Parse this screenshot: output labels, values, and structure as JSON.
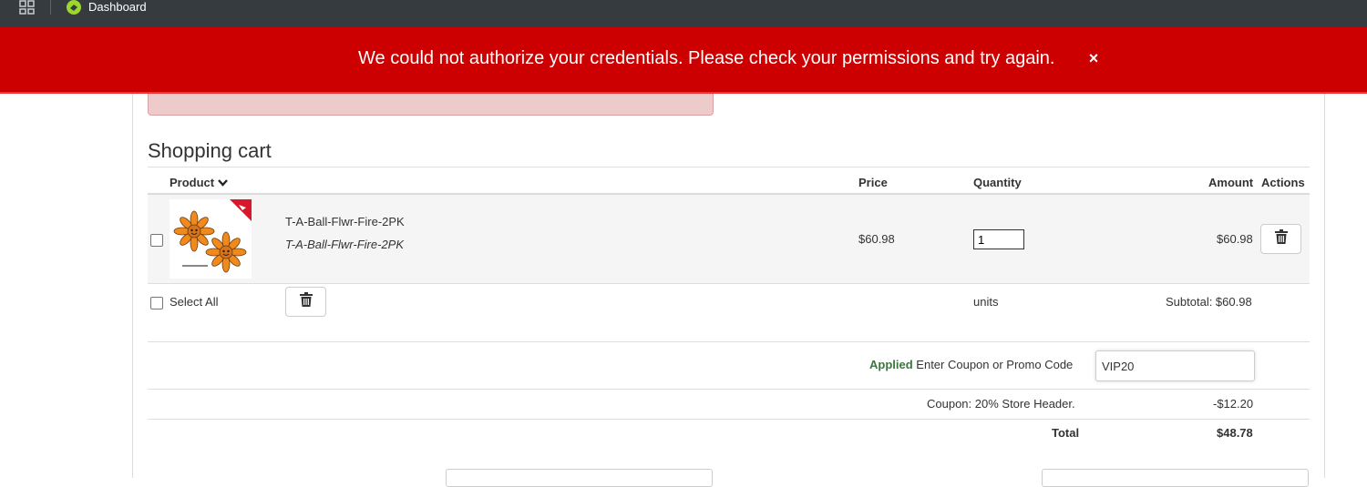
{
  "topbar": {
    "dashboard_label": "Dashboard"
  },
  "banner": {
    "message": "We could not authorize your credentials. Please check your permissions and try again.",
    "close_glyph": "×",
    "background_color": "#cc0000"
  },
  "cart": {
    "title": "Shopping cart",
    "headers": {
      "product": "Product",
      "price": "Price",
      "quantity": "Quantity",
      "amount": "Amount",
      "actions": "Actions"
    },
    "item": {
      "name": "T-A-Ball-Flwr-Fire-2PK",
      "sku": "T-A-Ball-Flwr-Fire-2PK",
      "price": "$60.98",
      "quantity": "1",
      "amount": "$60.98",
      "image_icon": "flower-product-image"
    },
    "select_all": "Select All",
    "units": "units",
    "subtotal": "Subtotal: $60.98"
  },
  "coupon": {
    "applied_label": "Applied",
    "prompt": "Enter Coupon or Promo Code",
    "value": "VIP20",
    "discount_label": "Coupon: 20% Store Header.",
    "discount_value": "-$12.20"
  },
  "totals": {
    "label": "Total",
    "value": "$48.78"
  },
  "colors": {
    "applied_green": "#3c763d",
    "topbar": "#353b3e"
  }
}
